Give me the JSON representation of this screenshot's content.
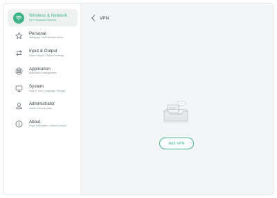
{
  "sidebar": {
    "items": [
      {
        "title": "Wireless & Network",
        "subtitle": "Wi-Fi  Bluetooth  Ethernet",
        "icon": "wifi-icon",
        "active": true
      },
      {
        "title": "Personal",
        "subtitle": "Wallpaper, Multi-Window Mode",
        "icon": "star-icon",
        "active": false
      },
      {
        "title": "Input & Output",
        "subtitle": "Sound output, Channel settings",
        "icon": "swap-arrows-icon",
        "active": false
      },
      {
        "title": "Application",
        "subtitle": "Application management",
        "icon": "app-grid-icon",
        "active": false
      },
      {
        "title": "System",
        "subtitle": "Date & Time, Language, Storage",
        "icon": "monitor-icon",
        "active": false
      },
      {
        "title": "Administrator",
        "subtitle": "Admin,Security,Data",
        "icon": "person-icon",
        "active": false
      },
      {
        "title": "About",
        "subtitle": "Legal information, Android version",
        "icon": "info-icon",
        "active": false
      }
    ]
  },
  "header": {
    "title": "VPN"
  },
  "main": {
    "add_button": "Add VPN",
    "illustration": "empty-vpn-illustration"
  },
  "colors": {
    "accent": "#3fb489",
    "sidebar_bg": "#ffffff",
    "content_bg": "#f4f5f6"
  }
}
